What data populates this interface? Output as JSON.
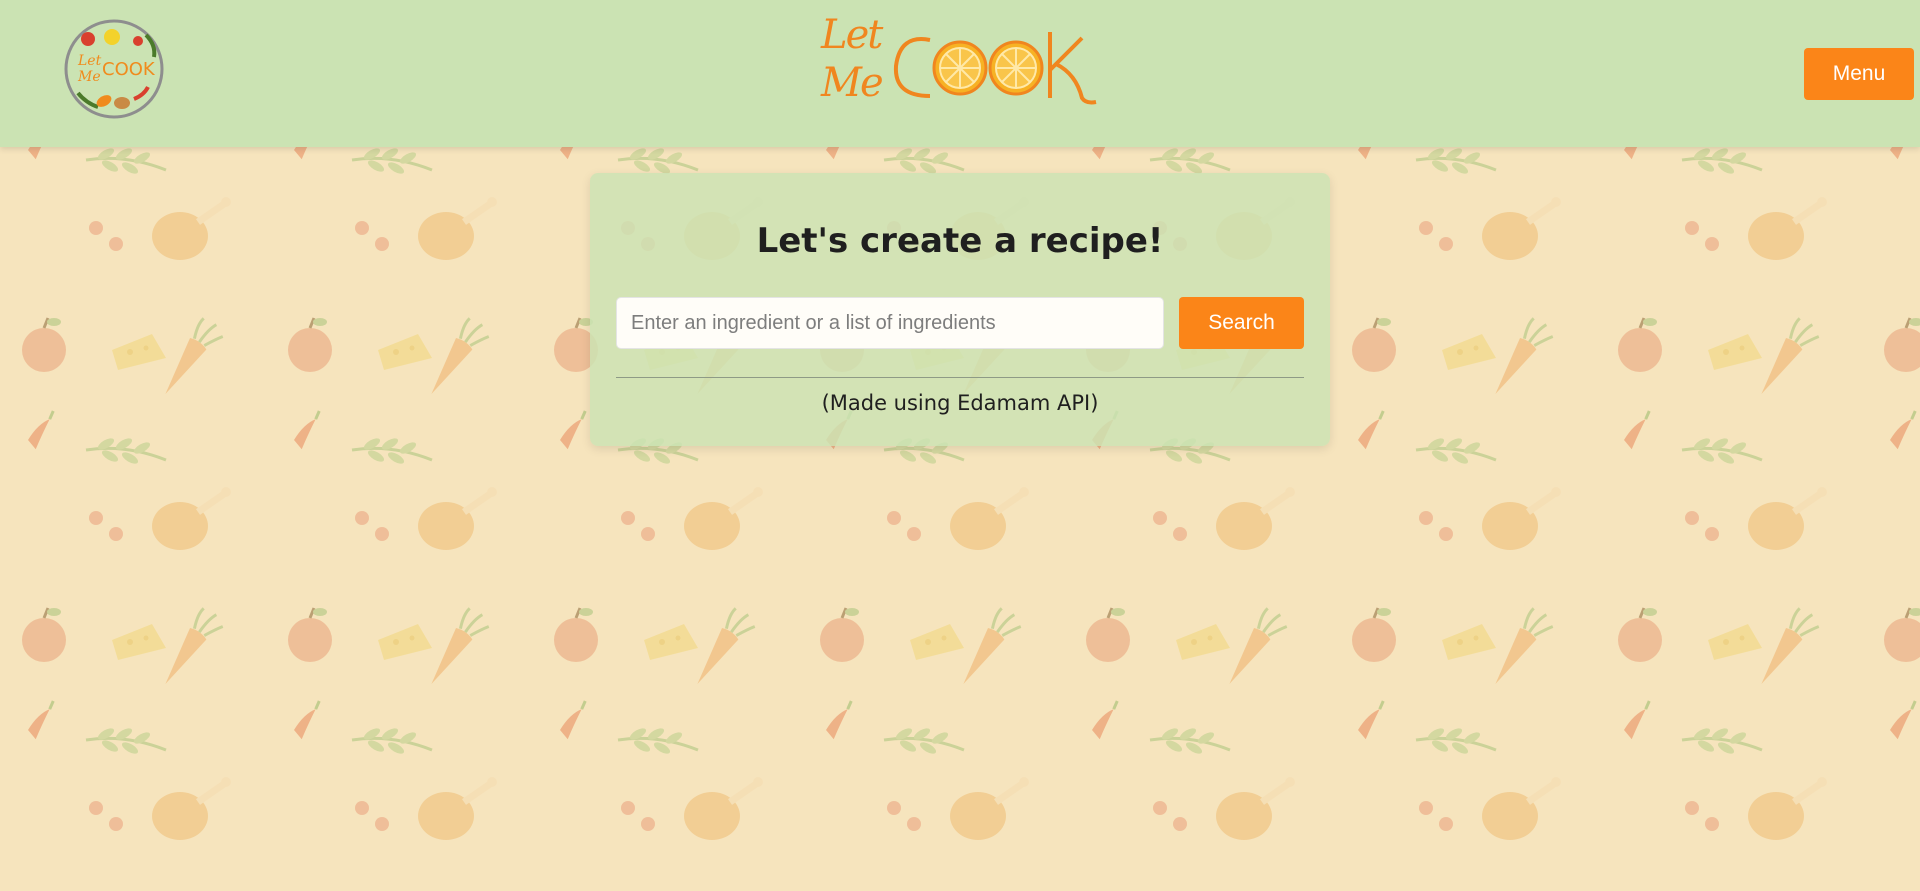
{
  "header": {
    "brand_top": "Let",
    "brand_bottom": "Me",
    "brand_word": "COOK",
    "menu_label": "Menu"
  },
  "card": {
    "title": "Let's create a recipe!",
    "search_placeholder": "Enter an ingredient or a list of ingredients",
    "search_value": "",
    "search_label": "Search",
    "credit": "(Made using Edamam API)"
  },
  "colors": {
    "header_bg": "#cbe3b3",
    "page_bg": "#f6e4bd",
    "accent": "#fb8518",
    "brand_orange": "#f0861f"
  },
  "icons": {
    "logo": "let-me-cook-badge-icon",
    "background": [
      "carrot-icon",
      "chili-pepper-icon",
      "apple-icon",
      "cheese-icon",
      "chicken-leg-icon",
      "herb-sprig-icon",
      "cherry-icon"
    ]
  }
}
